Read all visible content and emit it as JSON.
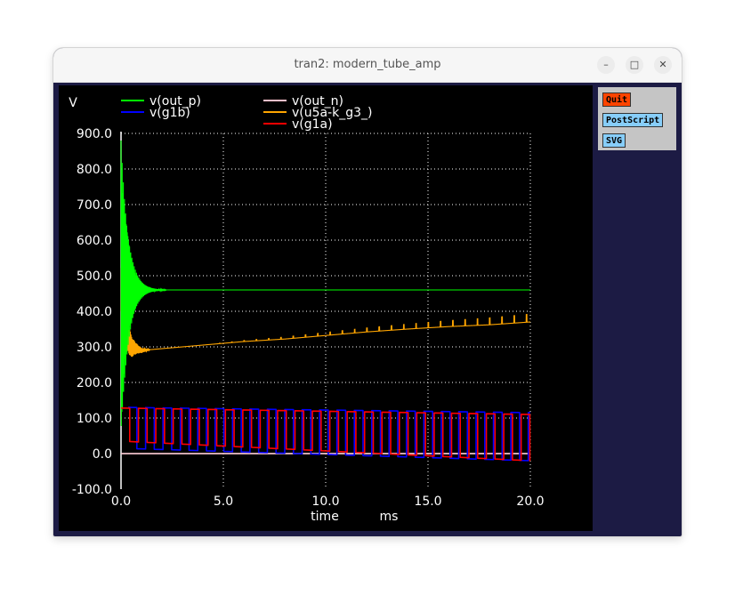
{
  "window": {
    "title": "tran2: modern_tube_amp",
    "minimize_glyph": "–",
    "maximize_glyph": "□",
    "close_glyph": "✕"
  },
  "panel": {
    "quit_label": "Quit",
    "postscript_label": "PostScript",
    "svg_label": "SVG",
    "colors": {
      "quit": "#ff4400",
      "postscript": "#87cefa",
      "svg": "#87cefa"
    }
  },
  "chart_data": {
    "type": "line",
    "y_unit_label": "V",
    "xlabel": "time",
    "x_unit": "ms",
    "xlim": [
      0,
      20
    ],
    "ylim": [
      -100,
      900
    ],
    "x_ticks": [
      "0.0",
      "5.0",
      "10.0",
      "15.0",
      "20.0"
    ],
    "y_ticks": [
      "900.0",
      "800.0",
      "700.0",
      "600.0",
      "500.0",
      "400.0",
      "300.0",
      "200.0",
      "100.0",
      "0.0",
      "-100.0"
    ],
    "grid": true,
    "grid_style": "dotted",
    "legend_placement": "top",
    "series": [
      {
        "name": "v(out_p)",
        "color": "#00ff00",
        "steady": 460,
        "initial_peak": 880
      },
      {
        "name": "v(g1b)",
        "color": "#0000ff",
        "start_range": [
          15,
          130
        ],
        "end_range": [
          -20,
          115
        ],
        "period_ms": 0.85
      },
      {
        "name": "v(out_n)",
        "color": "#ffc0cb",
        "steady": 0
      },
      {
        "name": "v(u5a-k_g3_)",
        "color": "#ffa500",
        "x": [
          0,
          0.5,
          1,
          2,
          4,
          6,
          8,
          10,
          12,
          14,
          16,
          18,
          20
        ],
        "values": [
          400,
          300,
          290,
          295,
          305,
          315,
          322,
          332,
          342,
          350,
          357,
          362,
          370
        ]
      },
      {
        "name": "v(g1a)",
        "color": "#ff0000",
        "start_range": [
          35,
          128
        ],
        "end_range": [
          -20,
          110
        ],
        "period_ms": 0.85
      }
    ]
  }
}
